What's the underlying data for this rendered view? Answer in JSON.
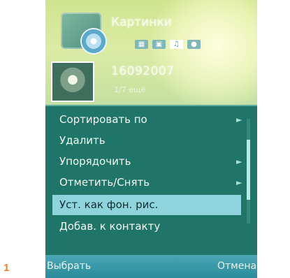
{
  "figure_number": "1",
  "header": {
    "folder_title": "Картинки",
    "tab_icons": [
      "grid-icon",
      "image-icon",
      "music-note-icon",
      "globe-icon"
    ]
  },
  "current_item": {
    "title": "16092007",
    "subtitle": "1/7 ещё"
  },
  "menu": {
    "items": [
      {
        "label": "Сортировать по",
        "has_submenu": true
      },
      {
        "label": "Удалить",
        "has_submenu": false
      },
      {
        "label": "Упорядочить",
        "has_submenu": true
      },
      {
        "label": "Отметить/Снять",
        "has_submenu": true
      },
      {
        "label": "Уст. как фон. рис.",
        "has_submenu": false,
        "selected": true
      },
      {
        "label": "Добав. к контакту",
        "has_submenu": false
      }
    ]
  },
  "softkeys": {
    "left": "Выбрать",
    "right": "Отмена"
  },
  "colors": {
    "menu_bg": "#1f7568",
    "highlight": "#8fd4dc",
    "softkey_bar": "#2b8b9c",
    "figure_number": "#e8822a"
  }
}
